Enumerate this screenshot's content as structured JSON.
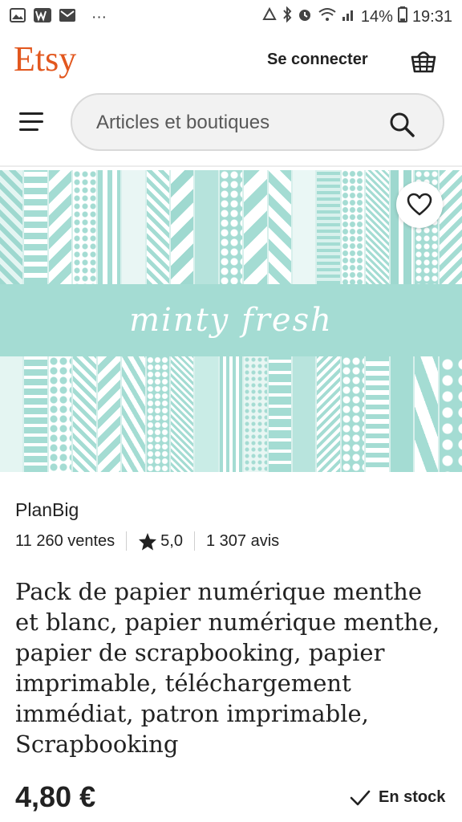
{
  "status_bar": {
    "notification_icons": [
      "image-icon",
      "w-icon",
      "mail-icon"
    ],
    "more": "···",
    "battery": "14%",
    "time": "19:31"
  },
  "header": {
    "logo": "Etsy",
    "sign_in": "Se connecter",
    "cart_icon": "basket-icon"
  },
  "search": {
    "placeholder": "Articles et boutiques",
    "icon": "search-icon"
  },
  "hero": {
    "band_text": "minty fresh",
    "accent": "#a4dcd3",
    "favorite_icon": "heart-icon"
  },
  "product": {
    "shop_name": "PlanBig",
    "sales": "11 260 ventes",
    "rating": "5,0",
    "reviews": "1 307 avis",
    "title": "Pack de papier numérique menthe et blanc, papier numérique menthe, papier de scrapbooking, papier imprimable, téléchargement immédiat, patron imprimable, Scrapbooking",
    "price": "4,80 €",
    "stock": "En stock"
  },
  "colors": {
    "brand": "#e2571e",
    "mint": "#a4dcd3"
  }
}
